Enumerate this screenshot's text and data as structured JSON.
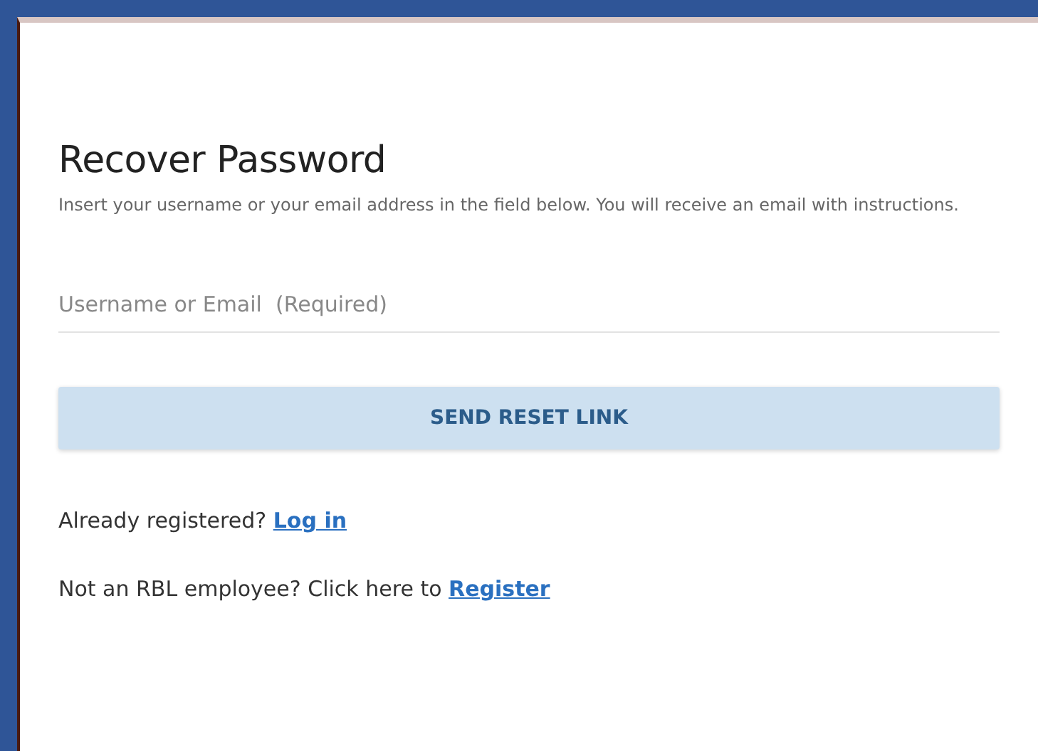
{
  "title": "Recover Password",
  "description": "Insert your username or your email address in the field below. You will receive an email with instructions.",
  "field": {
    "placeholder": "Username or Email  (Required)"
  },
  "button": "SEND RESET LINK",
  "links": [
    {
      "text": "Already registered?",
      "link": "Log in"
    },
    {
      "text": "Not an RBL employee? Click here to",
      "link": "Register"
    }
  ]
}
